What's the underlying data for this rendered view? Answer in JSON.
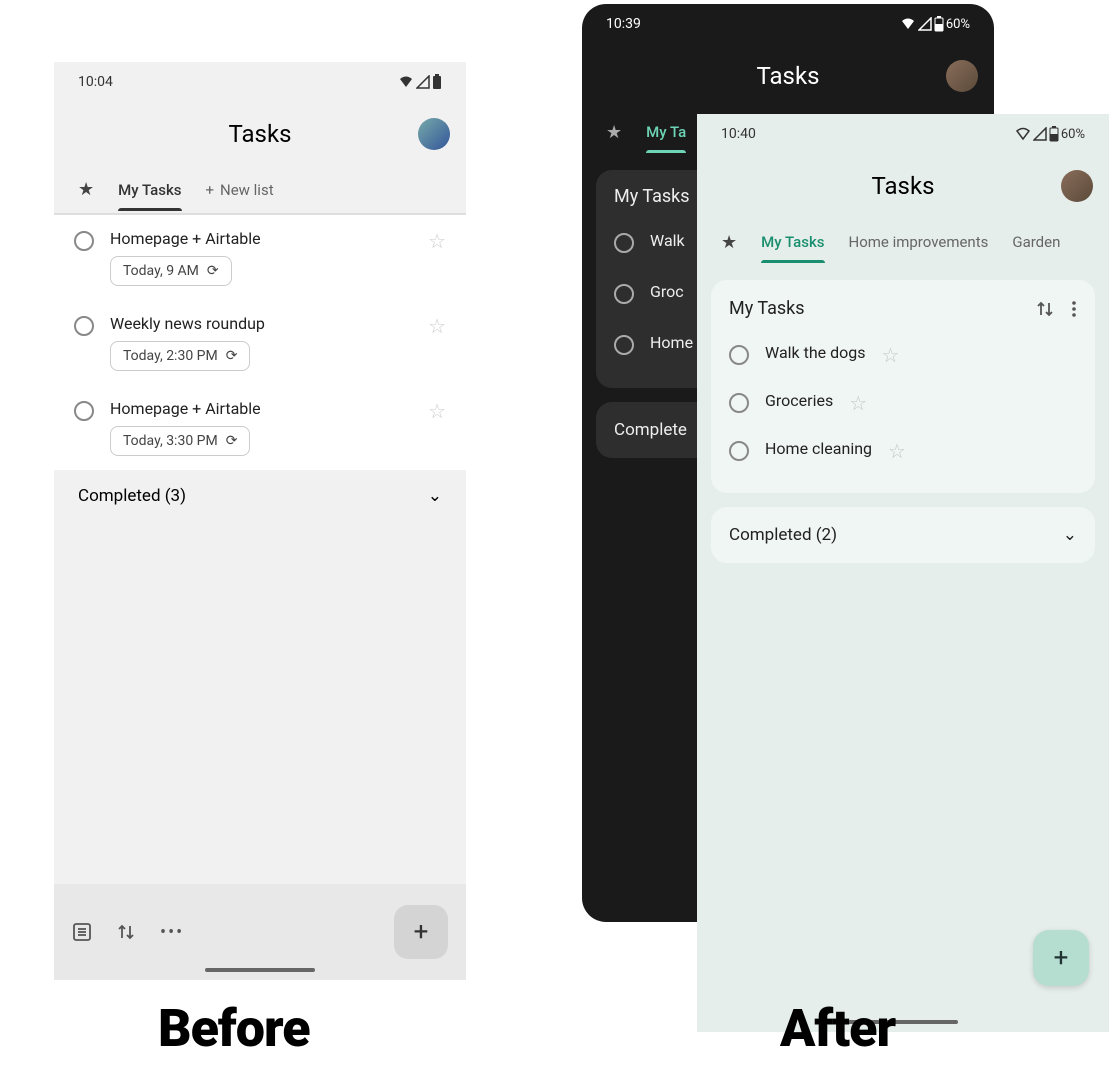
{
  "labels": {
    "before": "Before",
    "after": "After"
  },
  "p1": {
    "status": {
      "time": "10:04"
    },
    "title": "Tasks",
    "tabs": {
      "my": "My Tasks",
      "new": "New list"
    },
    "tasks": [
      {
        "title": "Homepage + Airtable",
        "chip": "Today, 9 AM"
      },
      {
        "title": "Weekly news roundup",
        "chip": "Today, 2:30 PM"
      },
      {
        "title": "Homepage + Airtable",
        "chip": "Today, 3:30 PM"
      }
    ],
    "completed": "Completed (3)"
  },
  "p2": {
    "status": {
      "time": "10:39",
      "bat": "60%"
    },
    "title": "Tasks",
    "tabs": {
      "my": "My Ta"
    },
    "card_title": "My Tasks",
    "tasks": [
      {
        "title": "Walk"
      },
      {
        "title": "Groc"
      },
      {
        "title": "Home"
      }
    ],
    "completed": "Complete"
  },
  "p3": {
    "status": {
      "time": "10:40",
      "bat": "60%"
    },
    "title": "Tasks",
    "tabs": {
      "my": "My Tasks",
      "home": "Home improvements",
      "garden": "Garden"
    },
    "card_title": "My Tasks",
    "tasks": [
      {
        "title": "Walk the dogs"
      },
      {
        "title": "Groceries"
      },
      {
        "title": "Home cleaning"
      }
    ],
    "completed": "Completed (2)"
  }
}
